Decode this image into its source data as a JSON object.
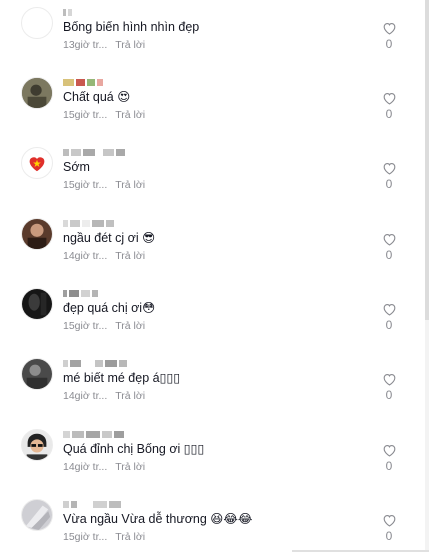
{
  "comments": [
    {
      "text": "Bống biến hình nhìn đẹp",
      "time": "13giờ tr...",
      "reply": "Trả lời",
      "likes": "0"
    },
    {
      "text": "Chất quá 😍",
      "time": "15giờ tr...",
      "reply": "Trả lời",
      "likes": "0"
    },
    {
      "text": "Sớm",
      "time": "15giờ tr...",
      "reply": "Trả lời",
      "likes": "0"
    },
    {
      "text": "ngầu đét cj ơi 😎",
      "time": "14giờ tr...",
      "reply": "Trả lời",
      "likes": "0"
    },
    {
      "text": "đẹp quá chị ơi😳",
      "time": "15giờ tr...",
      "reply": "Trả lời",
      "likes": "0"
    },
    {
      "text": "mé biết mé đẹp á▯▯▯",
      "time": "14giờ tr...",
      "reply": "Trả lời",
      "likes": "0"
    },
    {
      "text": "Quá đỉnh chị Bống ơi ▯▯▯",
      "time": "14giờ tr...",
      "reply": "Trả lời",
      "likes": "0"
    },
    {
      "text": "Vừa ngầu Vừa dễ thương 😆😂😂",
      "time": "15giờ tr...",
      "reply": "Trả lời",
      "likes": "0"
    }
  ],
  "icons": {
    "like": "heart-outline-icon"
  },
  "colors": {
    "text": "#161823",
    "muted": "#8a8b91",
    "background": "#ffffff"
  }
}
